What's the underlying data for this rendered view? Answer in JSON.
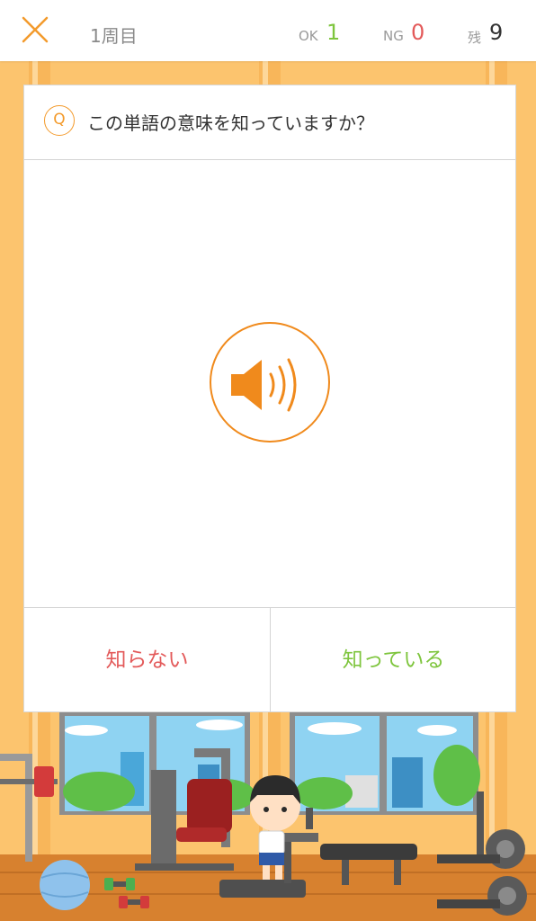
{
  "header": {
    "round": "1周目",
    "ok_label": "OK",
    "ok_count": "1",
    "ng_label": "NG",
    "ng_count": "0",
    "remaining_label": "残",
    "remaining_count": "9"
  },
  "question": {
    "icon_letter": "Q",
    "prompt": "この単語の意味を知っていますか？"
  },
  "answers": {
    "dont_know": "知らない",
    "know": "知っている"
  },
  "colors": {
    "accent_orange": "#f08a1c",
    "ok_green": "#7ec53d",
    "ng_red": "#e35a5a",
    "background": "#fcc46e"
  },
  "icons": [
    "close-icon",
    "q-icon",
    "speaker-icon"
  ]
}
